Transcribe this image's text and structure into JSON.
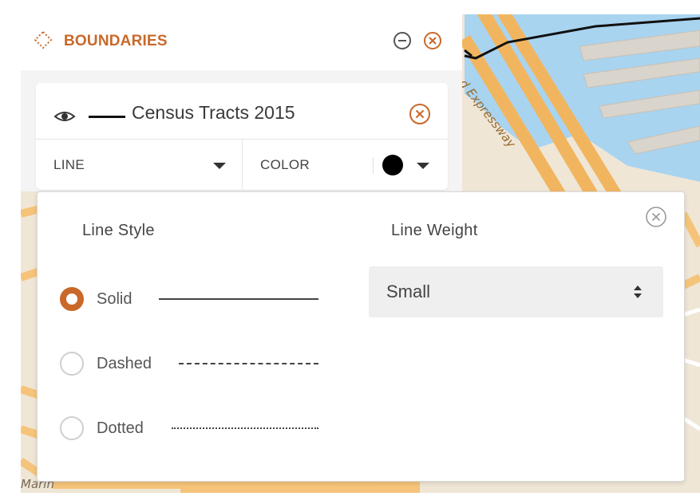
{
  "panel": {
    "title": "BOUNDARIES",
    "icon": "boundary-dotted-diamond-icon",
    "accent_color": "#c8692a"
  },
  "layer": {
    "name": "Census Tracts 2015",
    "line_dropdown_label": "LINE",
    "color_dropdown_label": "COLOR",
    "line_color": "#000000"
  },
  "popup": {
    "line_style_heading": "Line Style",
    "line_weight_heading": "Line Weight",
    "options": [
      {
        "label": "Solid",
        "selected": true
      },
      {
        "label": "Dashed",
        "selected": false
      },
      {
        "label": "Dotted",
        "selected": false
      }
    ],
    "line_weight_value": "Small"
  },
  "map": {
    "labels": [
      "d Expressway",
      "Marin"
    ]
  }
}
